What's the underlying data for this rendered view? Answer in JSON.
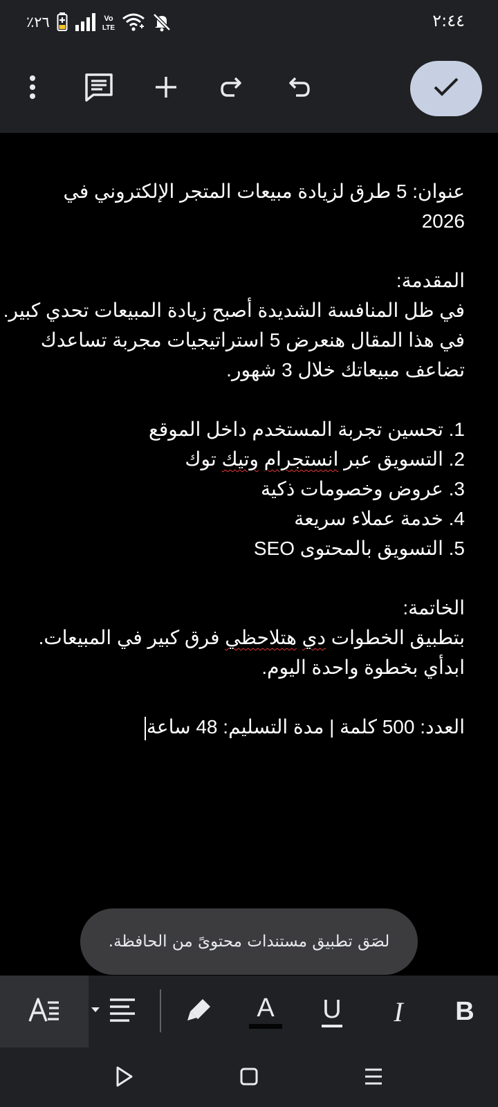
{
  "status_bar": {
    "time": "٢:٤٤",
    "battery": "٪٢٦",
    "icons": [
      "mute-icon",
      "wifi-icon",
      "volte-icon",
      "signal-icon",
      "battery-icon"
    ]
  },
  "toolbar": {
    "icons": [
      "more-vert-icon",
      "comment-icon",
      "add-icon",
      "redo-icon",
      "undo-icon",
      "check-icon"
    ],
    "accent_color": "#c7d0e3"
  },
  "document": {
    "title_line1": "عنوان: 5 طرق لزيادة مبيعات المتجر الإلكتروني في",
    "title_line2": "2026",
    "intro_heading": "المقدمة:",
    "intro_line1": "في ظل المنافسة الشديدة أصبح زيادة المبيعات تحدي كبير.",
    "intro_line2": "في هذا المقال هنعرض 5 استراتيجيات مجربة تساعدك",
    "intro_line3": "تضاعف مبيعاتك خلال 3 شهور.",
    "list_items": [
      "1. تحسين تجربة المستخدم داخل الموقع",
      "3. عروض وخصومات ذكية",
      "4. خدمة عملاء سريعة",
      "5. التسويق بالمحتوى SEO"
    ],
    "list_item2_a": "2. التسويق عبر ",
    "list_item2_b": "انستجرام",
    "list_item2_c": " ",
    "list_item2_d": "وتيك",
    "list_item2_e": " توك",
    "conclusion_heading": "الخاتمة:",
    "conclusion_a": "بتطبيق الخطوات ",
    "conclusion_b": "دي",
    "conclusion_c": " ",
    "conclusion_d": "هتلاحظي",
    "conclusion_e": " فرق كبير في المبيعات.",
    "conclusion_line2": "ابدأي بخطوة واحدة اليوم.",
    "footer_line": "العدد: 500 كلمة | مدة التسليم: 48 ساعة"
  },
  "snackbar": {
    "message": "لصَق تطبيق مستندات محتوىً من الحافظة."
  },
  "format_bar": {
    "icons": [
      "text-style-icon",
      "align-dropdown-icon",
      "highlight-icon",
      "text-color-icon",
      "underline-icon",
      "italic-icon",
      "bold-icon"
    ],
    "text_color_label": "A",
    "underline_label": "U",
    "italic_label": "I",
    "bold_label": "B"
  },
  "nav_bar": {
    "icons": [
      "back-icon",
      "home-icon",
      "recents-icon"
    ]
  }
}
